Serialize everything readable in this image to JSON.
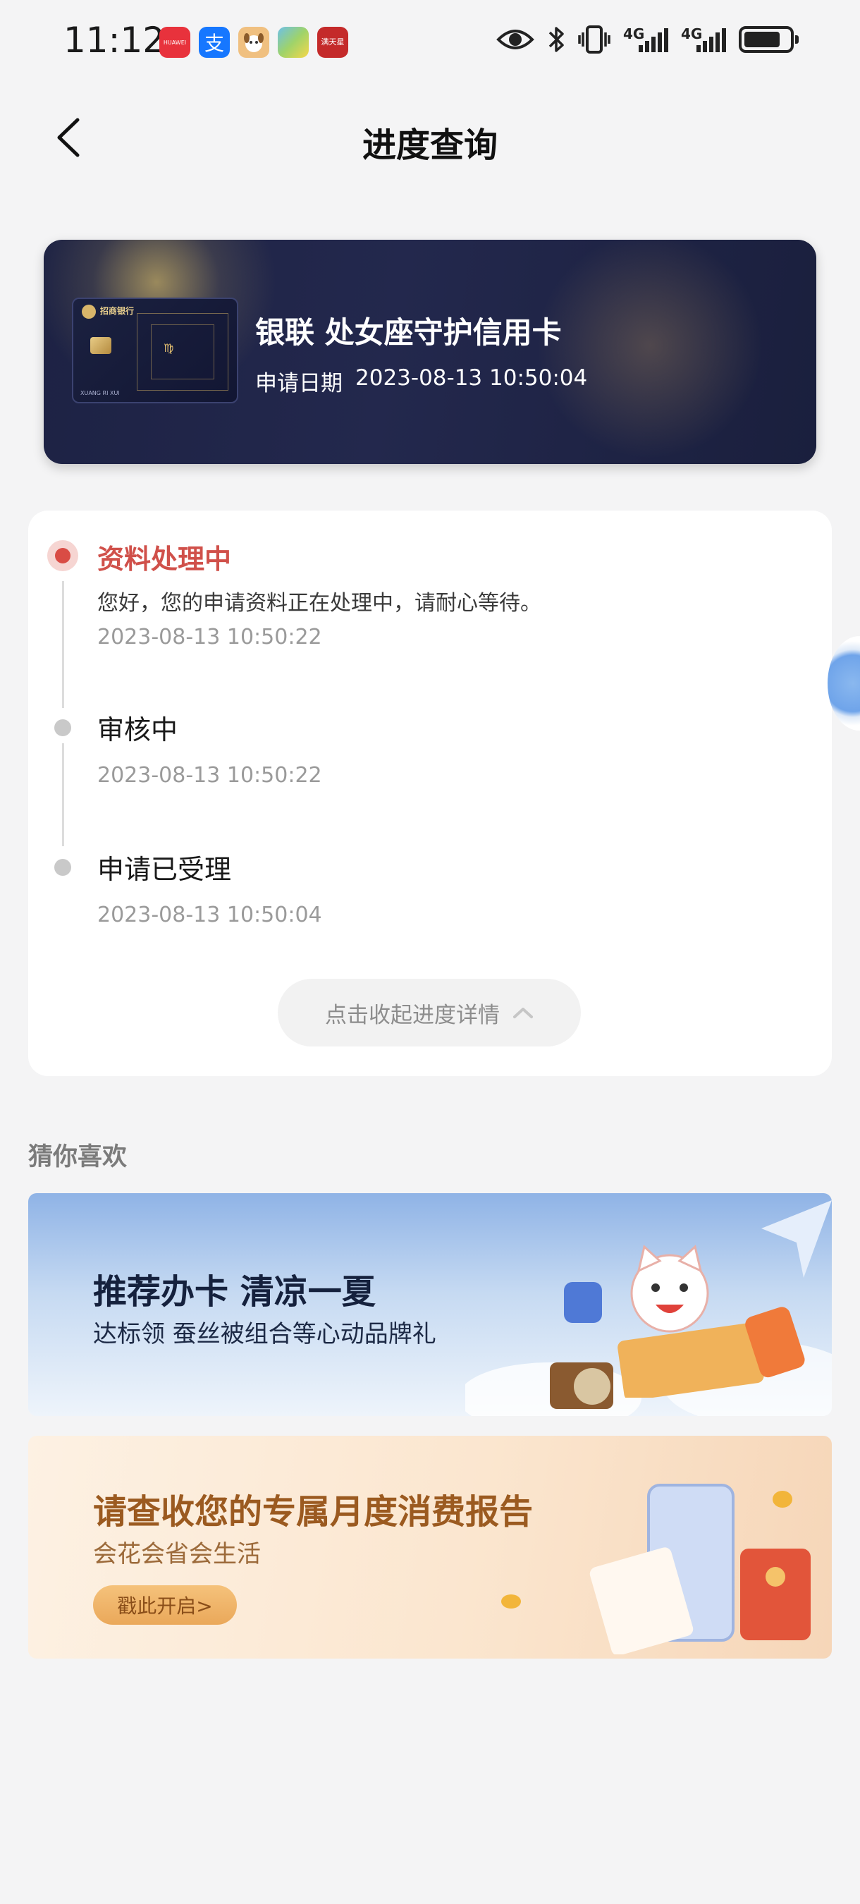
{
  "status_bar": {
    "time": "11:12",
    "apps": [
      {
        "icon": "huawei-appgallery-icon",
        "label": "HUAWEI",
        "color": "#e8323c"
      },
      {
        "icon": "alipay-icon",
        "label": "支",
        "color": "#1677ff"
      },
      {
        "icon": "dog-app-icon",
        "label": "",
        "color": "#f0c080"
      },
      {
        "icon": "game-app-icon",
        "label": "",
        "color": "#9fd36a"
      },
      {
        "icon": "red-app-icon",
        "label": "满天星",
        "color": "#c42a2a"
      }
    ],
    "network": [
      "4G",
      "4G"
    ],
    "icons": [
      "eye-icon",
      "bluetooth-icon",
      "vibrate-icon",
      "signal-icon",
      "signal-icon",
      "battery-icon"
    ]
  },
  "header": {
    "title": "进度查询"
  },
  "card": {
    "name": "银联 处女座守护信用卡",
    "date_label": "申请日期",
    "date_value": "2023-08-13 10:50:04",
    "card_bank": "招商银行",
    "card_mark": "♍",
    "card_holder": "XUANG RI XUI"
  },
  "progress": {
    "steps": [
      {
        "title": "资料处理中",
        "desc": "您好，您的申请资料正在处理中，请耐心等待。",
        "time": "2023-08-13 10:50:22",
        "active": true
      },
      {
        "title": "审核中",
        "desc": "",
        "time": "2023-08-13 10:50:22",
        "active": false
      },
      {
        "title": "申请已受理",
        "desc": "",
        "time": "2023-08-13 10:50:04",
        "active": false
      }
    ],
    "collapse_label": "点击收起进度详情"
  },
  "recommend": {
    "title": "猜你喜欢",
    "banners": [
      {
        "headline": "推荐办卡 清凉一夏",
        "sub": "达标领 蚕丝被组合等心动品牌礼"
      },
      {
        "headline": "请查收您的专属月度消费报告",
        "sub": "会花会省会生活",
        "button": "戳此开启>"
      }
    ]
  },
  "colors": {
    "accent_red": "#d0504a",
    "card_bg": "#1d2244",
    "page_bg": "#f4f4f5"
  }
}
